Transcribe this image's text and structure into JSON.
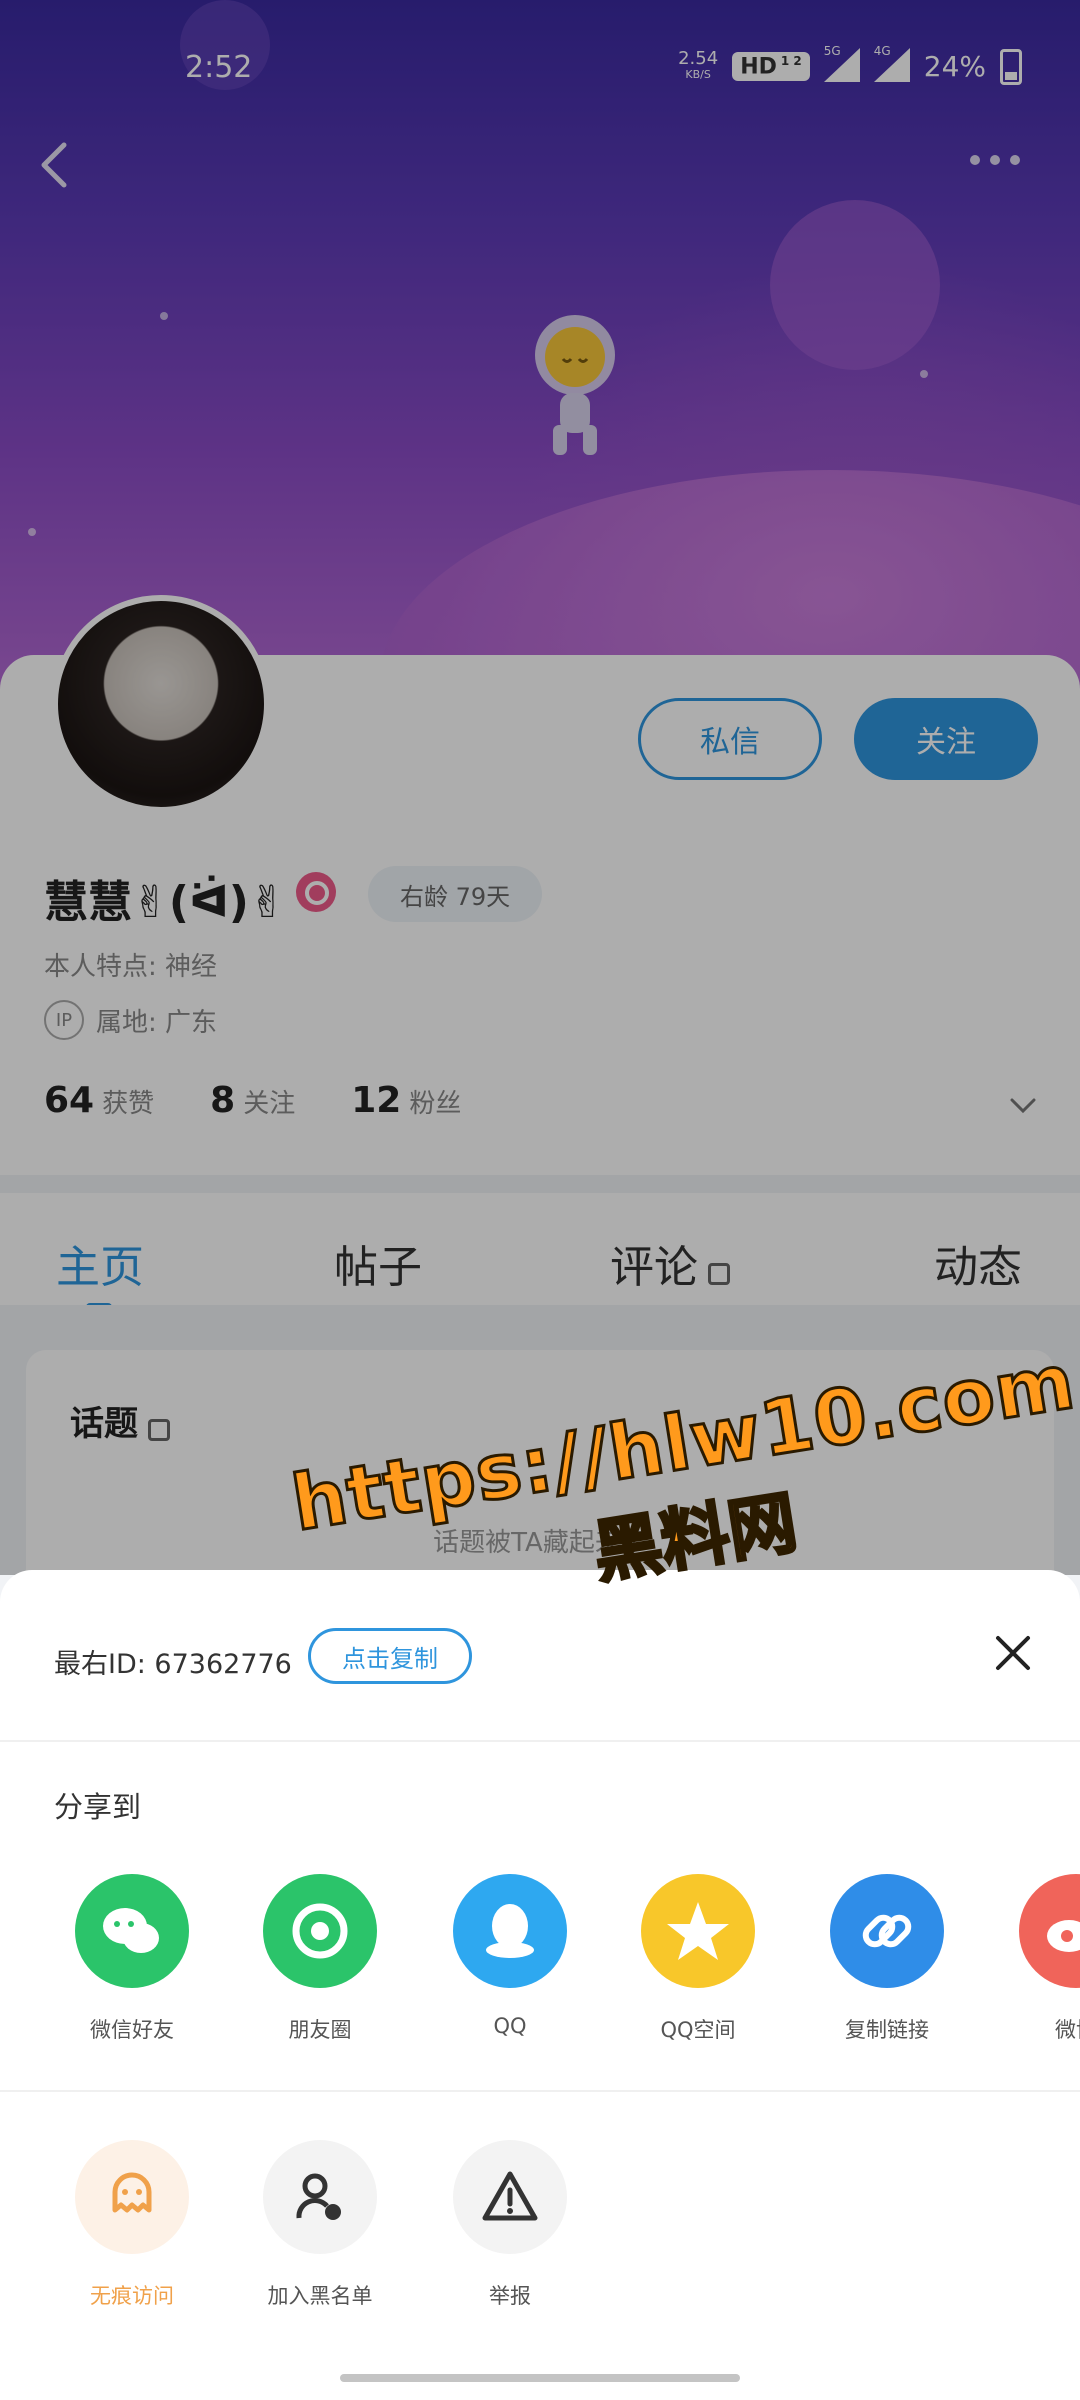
{
  "status_bar": {
    "time": "2:52",
    "net_speed": "2.54",
    "net_unit": "KB/S",
    "hd": "HD",
    "hd_sub": "1\n2",
    "sig1": "5G",
    "sig2": "4G",
    "battery": "24%"
  },
  "profile": {
    "username": "慧慧✌(ᐛ)✌",
    "age_badge": "右龄 79天",
    "trait": "本人特点: 神经",
    "ip_label": "IP",
    "location": "属地: 广东",
    "message_button": "私信",
    "follow_button": "关注",
    "stats": [
      {
        "value": "64",
        "label": "获赞"
      },
      {
        "value": "8",
        "label": "关注"
      },
      {
        "value": "12",
        "label": "粉丝"
      }
    ]
  },
  "tabs": [
    {
      "label": "主页",
      "active": true
    },
    {
      "label": "帖子",
      "active": false
    },
    {
      "label": "评论",
      "active": false,
      "locked": true
    },
    {
      "label": "动态",
      "active": false
    }
  ],
  "topic": {
    "title": "话题",
    "empty_text": "话题被TA藏起来了"
  },
  "share_sheet": {
    "id_text": "最右ID: 67362776",
    "copy_id_button": "点击复制",
    "share_title": "分享到",
    "share_targets": [
      {
        "label": "微信好友",
        "icon": "wechat-icon",
        "color": "#2bc46a"
      },
      {
        "label": "朋友圈",
        "icon": "moments-icon",
        "color": "#2bc46a"
      },
      {
        "label": "QQ",
        "icon": "qq-icon",
        "color": "#2ea8f0"
      },
      {
        "label": "QQ空间",
        "icon": "qzone-icon",
        "color": "#f8c72a"
      },
      {
        "label": "复制链接",
        "icon": "link-icon",
        "color": "#2f8de8"
      },
      {
        "label": "微博",
        "icon": "weibo-icon",
        "color": "#f0645a"
      }
    ],
    "actions": [
      {
        "label": "无痕访问",
        "icon": "ghost-icon",
        "color": "#f0a14a"
      },
      {
        "label": "加入黑名单",
        "icon": "blacklist-icon",
        "color": "#555555"
      },
      {
        "label": "举报",
        "icon": "report-icon",
        "color": "#555555"
      }
    ]
  },
  "watermark": {
    "line1": "https://hlw10.com",
    "line2": "黑料网"
  }
}
